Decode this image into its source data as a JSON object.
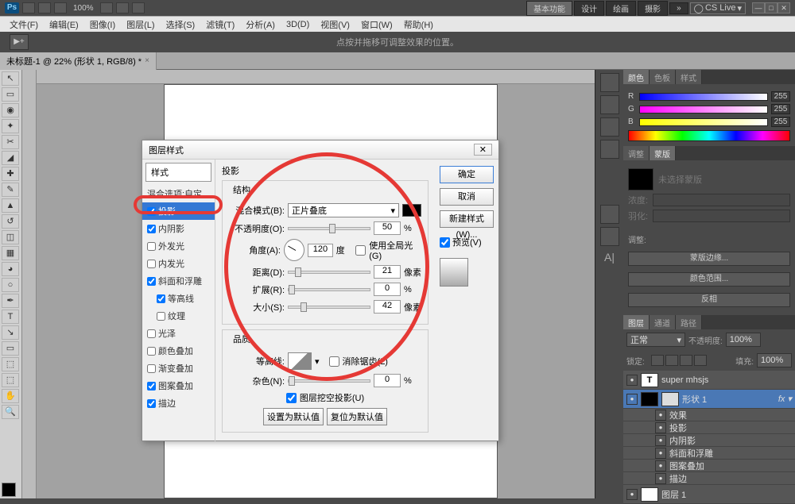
{
  "app": {
    "logo": "Ps",
    "zoom": "100%"
  },
  "workspace": {
    "active": "基本功能",
    "items": [
      "设计",
      "绘画",
      "摄影"
    ],
    "cs": "CS Live"
  },
  "menus": [
    "文件(F)",
    "编辑(E)",
    "图像(I)",
    "图层(L)",
    "选择(S)",
    "滤镜(T)",
    "分析(A)",
    "3D(D)",
    "视图(V)",
    "窗口(W)",
    "帮助(H)"
  ],
  "opt_hint": "点按并拖移可调整效果的位置。",
  "opt_arrow": "▶+",
  "doc_tab": "未标题-1 @ 22% (形状 1, RGB/8) *",
  "panels": {
    "color_tabs": [
      "颜色",
      "色板",
      "样式"
    ],
    "rgb": {
      "r": "255",
      "g": "255",
      "b": "255"
    },
    "adjust_tabs": [
      "调整",
      "蒙版"
    ],
    "mask_hint": "未选择蒙版",
    "mask_l1": "浓度:",
    "mask_l2": "羽化:",
    "mask_head": "调整:",
    "mask_btn1": "蒙版边缘...",
    "mask_btn2": "颜色范围...",
    "mask_btn3": "反相",
    "layer_tabs": [
      "图层",
      "通道",
      "路径"
    ],
    "blend": "正常",
    "opacity_l": "不透明度:",
    "opacity_v": "100%",
    "lock_l": "锁定:",
    "fill_l": "填充:",
    "fill_v": "100%",
    "layers": [
      {
        "name": "super mhsjs",
        "type": "T"
      },
      {
        "name": "形状 1",
        "sel": true
      },
      {
        "name": "效果",
        "fx": true
      },
      {
        "name": "投影",
        "fx": true
      },
      {
        "name": "内阴影",
        "fx": true
      },
      {
        "name": "斜面和浮雕",
        "fx": true
      },
      {
        "name": "图案叠加",
        "fx": true
      },
      {
        "name": "描边",
        "fx": true
      },
      {
        "name": "图层 1"
      }
    ]
  },
  "dialog": {
    "title": "图层样式",
    "side_head": "样式",
    "side_opt": "混合选项:自定",
    "side": [
      {
        "l": "投影",
        "c": true,
        "sel": true
      },
      {
        "l": "内阴影",
        "c": true
      },
      {
        "l": "外发光",
        "c": false
      },
      {
        "l": "内发光",
        "c": false
      },
      {
        "l": "斜面和浮雕",
        "c": true
      },
      {
        "l": "等高线",
        "c": true,
        "sub": true
      },
      {
        "l": "纹理",
        "c": false,
        "sub": true
      },
      {
        "l": "光泽",
        "c": false
      },
      {
        "l": "颜色叠加",
        "c": false
      },
      {
        "l": "渐变叠加",
        "c": false
      },
      {
        "l": "图案叠加",
        "c": true
      },
      {
        "l": "描边",
        "c": true
      }
    ],
    "section1": "投影",
    "group1": "结构",
    "blend_l": "混合模式(B):",
    "blend_v": "正片叠底",
    "opac_l": "不透明度(O):",
    "opac_v": "50",
    "pct": "%",
    "angle_l": "角度(A):",
    "angle_v": "120",
    "deg": "度",
    "global": "使用全局光(G)",
    "dist_l": "距离(D):",
    "dist_v": "21",
    "px": "像素",
    "spread_l": "扩展(R):",
    "spread_v": "0",
    "size_l": "大小(S):",
    "size_v": "42",
    "group2": "品质",
    "contour_l": "等高线:",
    "antialias": "消除锯齿(L)",
    "noise_l": "杂色(N):",
    "noise_v": "0",
    "knock": "图层挖空投影(U)",
    "btn_setdef": "设置为默认值",
    "btn_resetdef": "复位为默认值",
    "ok": "确定",
    "cancel": "取消",
    "new": "新建样式(W)...",
    "preview": "预览(V)"
  }
}
